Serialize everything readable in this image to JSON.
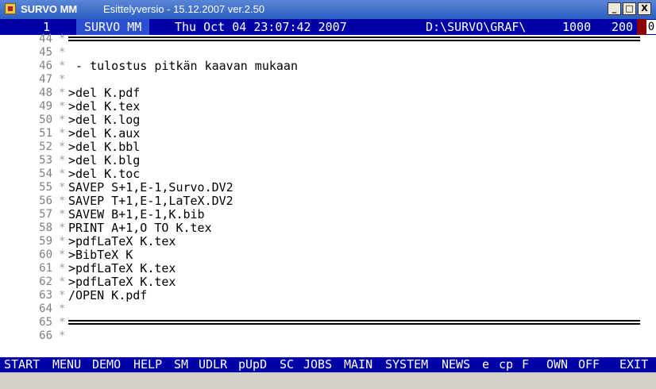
{
  "window": {
    "app_name": "SURVO MM",
    "subtitle": "Esittelyversio  - 15.12.2007 ver.2.50",
    "icon": "survo-app-icon",
    "buttons": {
      "minimize": "_",
      "maximize": "□",
      "close": "X"
    }
  },
  "status": {
    "window_no": "1",
    "label": "SURVO MM",
    "datetime": "Thu Oct 04 23:07:42 2007",
    "path": "D:\\SURVO\\GRAF\\",
    "value1": "1000",
    "value2": "200",
    "value3": "0"
  },
  "editor": {
    "lines": [
      {
        "num": "44",
        "ctrl": "*",
        "text": "",
        "rule": true
      },
      {
        "num": "45",
        "ctrl": "*",
        "text": ""
      },
      {
        "num": "46",
        "ctrl": "*",
        "text": " - tulostus pitkän kaavan mukaan"
      },
      {
        "num": "47",
        "ctrl": "*",
        "text": ""
      },
      {
        "num": "48",
        "ctrl": "*",
        "text": ">del K.pdf"
      },
      {
        "num": "49",
        "ctrl": "*",
        "text": ">del K.tex"
      },
      {
        "num": "50",
        "ctrl": "*",
        "text": ">del K.log"
      },
      {
        "num": "51",
        "ctrl": "*",
        "text": ">del K.aux"
      },
      {
        "num": "52",
        "ctrl": "*",
        "text": ">del K.bbl"
      },
      {
        "num": "53",
        "ctrl": "*",
        "text": ">del K.blg"
      },
      {
        "num": "54",
        "ctrl": "*",
        "text": ">del K.toc"
      },
      {
        "num": "55",
        "ctrl": "*",
        "text": "SAVEP S+1,E-1,Survo.DV2"
      },
      {
        "num": "56",
        "ctrl": "*",
        "text": "SAVEP T+1,E-1,LaTeX.DV2"
      },
      {
        "num": "57",
        "ctrl": "*",
        "text": "SAVEW B+1,E-1,K.bib"
      },
      {
        "num": "58",
        "ctrl": "*",
        "text": "PRINT A+1,O TO K.tex"
      },
      {
        "num": "59",
        "ctrl": "*",
        "text": ">pdfLaTeX K.tex"
      },
      {
        "num": "60",
        "ctrl": "*",
        "text": ">BibTeX K"
      },
      {
        "num": "61",
        "ctrl": "*",
        "text": ">pdfLaTeX K.tex"
      },
      {
        "num": "62",
        "ctrl": "*",
        "text": ">pdfLaTeX K.tex"
      },
      {
        "num": "63",
        "ctrl": "*",
        "text": "/OPEN K.pdf"
      },
      {
        "num": "64",
        "ctrl": "*",
        "text": ""
      },
      {
        "num": "65",
        "ctrl": "*",
        "text": "",
        "rule": true
      },
      {
        "num": "66",
        "ctrl": "*",
        "text": ""
      }
    ]
  },
  "function_keys": [
    "START",
    "MENU",
    "DEMO",
    "HELP",
    "SM",
    "UDLR",
    "pUpD",
    "SC",
    "JOBS",
    "MAIN",
    "SYSTEM",
    "NEWS",
    "e",
    "cp",
    "F",
    "OWN",
    "OFF",
    "EXIT"
  ]
}
